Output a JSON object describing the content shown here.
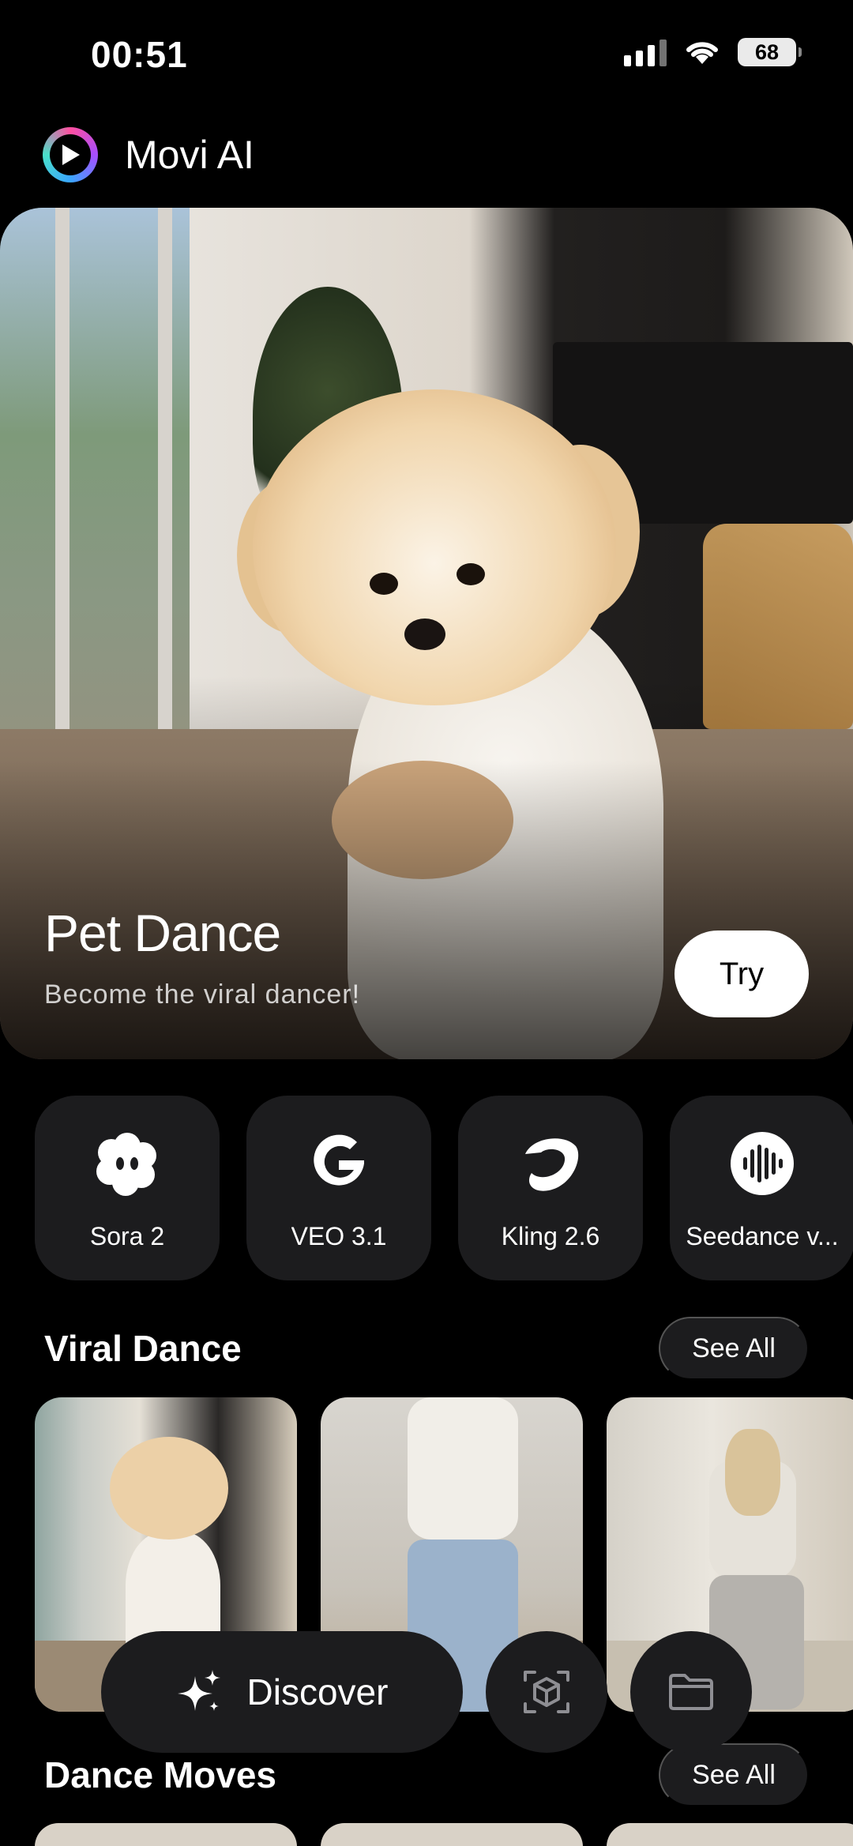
{
  "status_bar": {
    "time": "00:51",
    "battery": "68"
  },
  "app": {
    "title": "Movi AI"
  },
  "hero": {
    "title": "Pet Dance",
    "subtitle": "Become the viral dancer!",
    "cta": "Try"
  },
  "models": [
    {
      "label": "Sora 2",
      "icon": "sora-icon"
    },
    {
      "label": "VEO 3.1",
      "icon": "google-icon"
    },
    {
      "label": "Kling 2.6",
      "icon": "kling-icon"
    },
    {
      "label": "Seedance v...",
      "icon": "seedance-icon"
    }
  ],
  "sections": {
    "viral_dance": {
      "title": "Viral Dance",
      "see_all": "See All"
    },
    "dance_moves": {
      "title": "Dance Moves",
      "see_all": "See All"
    }
  },
  "nav": {
    "discover_label": "Discover",
    "discover_icon": "sparkle-icon",
    "middle_icon": "cube-scan-icon",
    "right_icon": "folder-icon"
  },
  "colors": {
    "background": "#000000",
    "surface": "#1c1c1e",
    "text": "#ffffff"
  }
}
